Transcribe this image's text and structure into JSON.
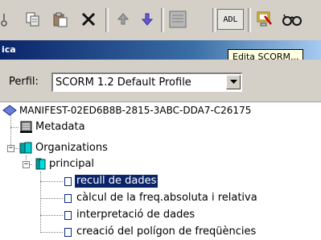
{
  "window": {
    "title": "ica"
  },
  "toolbar": {
    "buttons": [
      {
        "name": "copy-icon"
      },
      {
        "name": "paste-icon"
      },
      {
        "name": "delete-icon"
      },
      {
        "name": "move-up-icon"
      },
      {
        "name": "move-down-icon"
      },
      {
        "name": "document-icon"
      },
      {
        "name": "adl-button",
        "label": "ADL"
      },
      {
        "name": "edit-scorm-icon"
      },
      {
        "name": "preview-icon"
      }
    ],
    "tooltip": "Edita SCORM..."
  },
  "profile": {
    "label": "Perfil:",
    "selected": "SCORM 1.2 Default Profile"
  },
  "tree": {
    "root": "MANIFEST-02ED6B8B-2815-3ABC-DDA7-C26175",
    "metadata": "Metadata",
    "organizations": "Organizations",
    "organization": "principal",
    "items": [
      "recull de dades",
      "càlcul de la freq.absoluta i relativa",
      "interpretació de dades",
      "creació del polígon de freqüències"
    ],
    "selected_index": 0
  },
  "colors": {
    "selection": "#0a246a",
    "titlebar_start": "#0a246a",
    "toolbar_bg": "#d4d0c8",
    "tooltip_bg": "#ffffe1",
    "folder_cyan": "#00c0c0"
  }
}
